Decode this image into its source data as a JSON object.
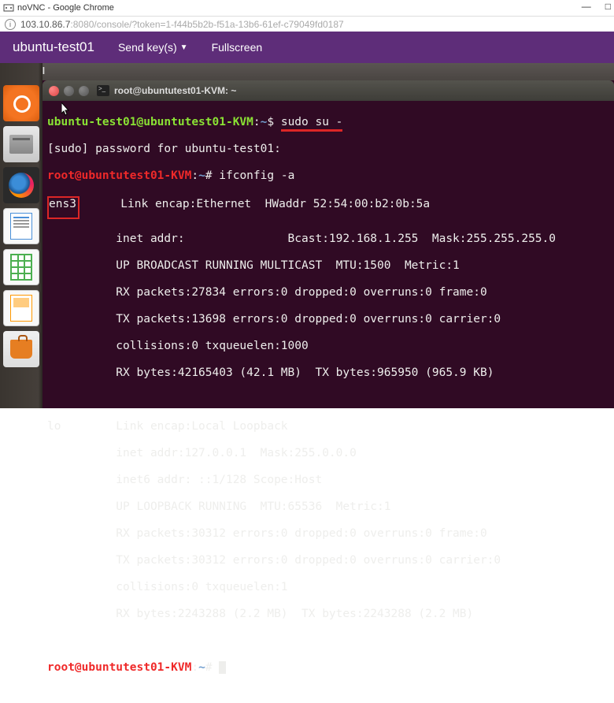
{
  "browser": {
    "title": "noVNC - Google Chrome",
    "url_host": "103.10.86.7",
    "url_port_path": ":8080/console/?token=1-f44b5b2b-f51a-13b6-61ef-c79049fd0187"
  },
  "vnc": {
    "hostname": "ubuntu-test01",
    "menu_sendkeys": "Send key(s)",
    "menu_fullscreen": "Fullscreen"
  },
  "desktop": {
    "terminal_label": "Terminal"
  },
  "term_window": {
    "title": "root@ubuntutest01-KVM: ~"
  },
  "terminal": {
    "line1_prompt_user": "ubuntu-test01@ubuntutest01-KVM",
    "line1_path": "~",
    "line1_cmd": "sudo su -",
    "line2": "[sudo] password for ubuntu-test01:",
    "line3_prompt_user": "root@ubuntutest01-KVM",
    "line3_path": "~",
    "line3_cmd": "ifconfig -a",
    "iface1": "ens3",
    "iface1_l1a": "      Link encap:Ethernet  HWaddr 52:54:00:b2:0b:5a",
    "iface1_l2": "          inet addr:               Bcast:192.168.1.255  Mask:255.255.255.0",
    "iface1_l3": "          UP BROADCAST RUNNING MULTICAST  MTU:1500  Metric:1",
    "iface1_l4": "          RX packets:27834 errors:0 dropped:0 overruns:0 frame:0",
    "iface1_l5": "          TX packets:13698 errors:0 dropped:0 overruns:0 carrier:0",
    "iface1_l6": "          collisions:0 txqueuelen:1000",
    "iface1_l7": "          RX bytes:42165403 (42.1 MB)  TX bytes:965950 (965.9 KB)",
    "blank": " ",
    "iface2_l1": "lo        Link encap:Local Loopback",
    "iface2_l2": "          inet addr:127.0.0.1  Mask:255.0.0.0",
    "iface2_l3": "          inet6 addr: ::1/128 Scope:Host",
    "iface2_l4": "          UP LOOPBACK RUNNING  MTU:65536  Metric:1",
    "iface2_l5": "          RX packets:30312 errors:0 dropped:0 overruns:0 frame:0",
    "iface2_l6": "          TX packets:30312 errors:0 dropped:0 overruns:0 carrier:0",
    "iface2_l7": "          collisions:0 txqueuelen:1",
    "iface2_l8": "          RX bytes:2243288 (2.2 MB)  TX bytes:2243288 (2.2 MB)",
    "final_prompt_user": "root@ubuntutest01-KVM",
    "final_path": "~"
  }
}
